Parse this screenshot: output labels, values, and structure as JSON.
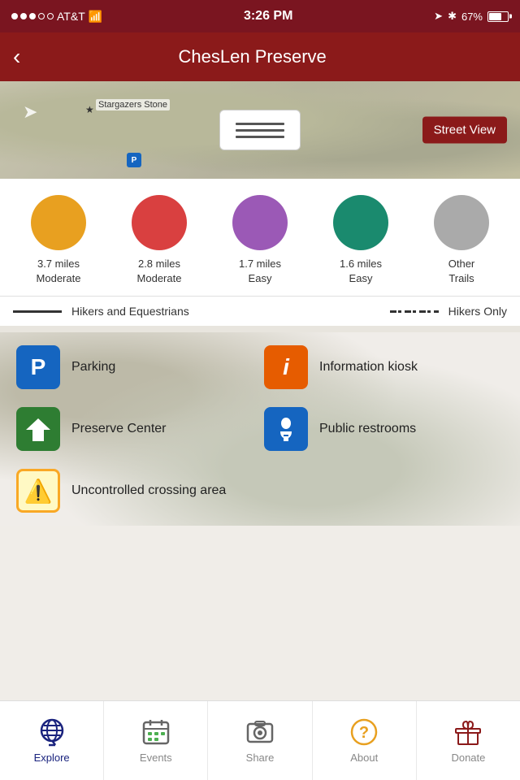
{
  "status": {
    "carrier": "AT&T",
    "time": "3:26 PM",
    "battery": "67%"
  },
  "header": {
    "title": "ChesLen Preserve",
    "back_label": "‹"
  },
  "map": {
    "label": "Stargazers Stone",
    "street_view_label": "Street View"
  },
  "trails": [
    {
      "color": "#e8a020",
      "miles": "3.7 miles",
      "difficulty": "Moderate"
    },
    {
      "color": "#d94040",
      "miles": "2.8 miles",
      "difficulty": "Moderate"
    },
    {
      "color": "#9b59b6",
      "miles": "1.7 miles",
      "difficulty": "Easy"
    },
    {
      "color": "#1a8a6e",
      "miles": "1.6 miles",
      "difficulty": "Easy"
    },
    {
      "color": "#aaaaaa",
      "miles": "Other",
      "difficulty": "Trails"
    }
  ],
  "line_legend": {
    "solid_label": "Hikers and Equestrians",
    "dashed_label": "Hikers Only"
  },
  "legend_items": [
    {
      "id": "parking",
      "icon": "P",
      "label": "Parking",
      "color": "#1565c0",
      "type": "letter"
    },
    {
      "id": "info",
      "icon": "i",
      "label": "Information kiosk",
      "color": "#e65c00",
      "type": "letter"
    },
    {
      "id": "preserve",
      "icon": "🏠",
      "label": "Preserve Center",
      "color": "#2e7d32",
      "type": "emoji"
    },
    {
      "id": "restroom",
      "icon": "🚽",
      "label": "Public restrooms",
      "color": "#1565c0",
      "type": "emoji"
    },
    {
      "id": "warning",
      "icon": "⚠️",
      "label": "Uncontrolled crossing area",
      "color": "warning",
      "type": "emoji"
    }
  ],
  "nav": {
    "items": [
      {
        "id": "explore",
        "label": "Explore",
        "active": true
      },
      {
        "id": "events",
        "label": "Events",
        "active": false
      },
      {
        "id": "share",
        "label": "Share",
        "active": false
      },
      {
        "id": "about",
        "label": "About",
        "active": false
      },
      {
        "id": "donate",
        "label": "Donate",
        "active": false
      }
    ]
  }
}
